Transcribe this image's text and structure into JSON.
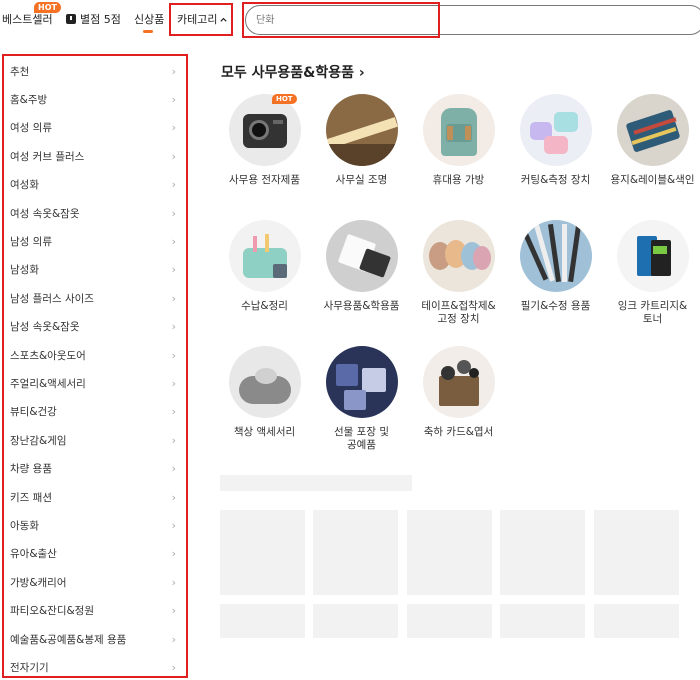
{
  "nav": {
    "best_label": "베스트셀러",
    "best_badge": "HOT",
    "store_label": "별점 5점",
    "new_label": "신상품",
    "category_label": "카테고리",
    "category_chevron": "^"
  },
  "search": {
    "placeholder": "단화"
  },
  "sidebar": {
    "items": [
      {
        "label": "추천"
      },
      {
        "label": "홈&주방"
      },
      {
        "label": "여성 의류"
      },
      {
        "label": "여성 커브 플러스"
      },
      {
        "label": "여성화"
      },
      {
        "label": "여성 속옷&잠옷"
      },
      {
        "label": "남성 의류"
      },
      {
        "label": "남성화"
      },
      {
        "label": "남성 플러스 사이즈"
      },
      {
        "label": "남성 속옷&잠옷"
      },
      {
        "label": "스포츠&아웃도어"
      },
      {
        "label": "주얼리&액세서리"
      },
      {
        "label": "뷰티&건강"
      },
      {
        "label": "장난감&게임"
      },
      {
        "label": "차량 용품"
      },
      {
        "label": "키즈 패션"
      },
      {
        "label": "아동화"
      },
      {
        "label": "유아&출산"
      },
      {
        "label": "가방&캐리어"
      },
      {
        "label": "파티오&잔디&정원"
      },
      {
        "label": "예술품&공예품&봉제 용품"
      },
      {
        "label": "전자기기"
      }
    ],
    "chevron": "›"
  },
  "main": {
    "section_title": "모두 사무용품&학용품 ›",
    "categories": [
      {
        "label": "사무용 전자제품",
        "badge": "HOT",
        "icon": "projector-icon"
      },
      {
        "label": "사무실 조명",
        "icon": "lamp-icon"
      },
      {
        "label": "휴대용 가방",
        "icon": "backpack-icon"
      },
      {
        "label": "커팅&측정 장치",
        "icon": "tape-dispenser-icon"
      },
      {
        "label": "용지&레이블&색인",
        "icon": "notebook-icon"
      },
      {
        "label": "수납&정리",
        "icon": "organizer-icon"
      },
      {
        "label": "사무용품&학용품",
        "icon": "desk-organizer-icon"
      },
      {
        "label": "테이프&접착제&고정 장치",
        "icon": "tape-rolls-icon"
      },
      {
        "label": "필기&수정 용품",
        "icon": "pens-icon"
      },
      {
        "label": "잉크 카트리지&토너",
        "icon": "ink-cartridge-icon"
      },
      {
        "label": "책상 액세서리",
        "icon": "mousepad-icon"
      },
      {
        "label": "선물 포장 및 공예품",
        "icon": "gift-box-icon"
      },
      {
        "label": "축하 카드&엽서",
        "icon": "greeting-card-icon"
      }
    ]
  },
  "colors": {
    "accent": "#f57224",
    "highlight_border": "#e02020"
  }
}
